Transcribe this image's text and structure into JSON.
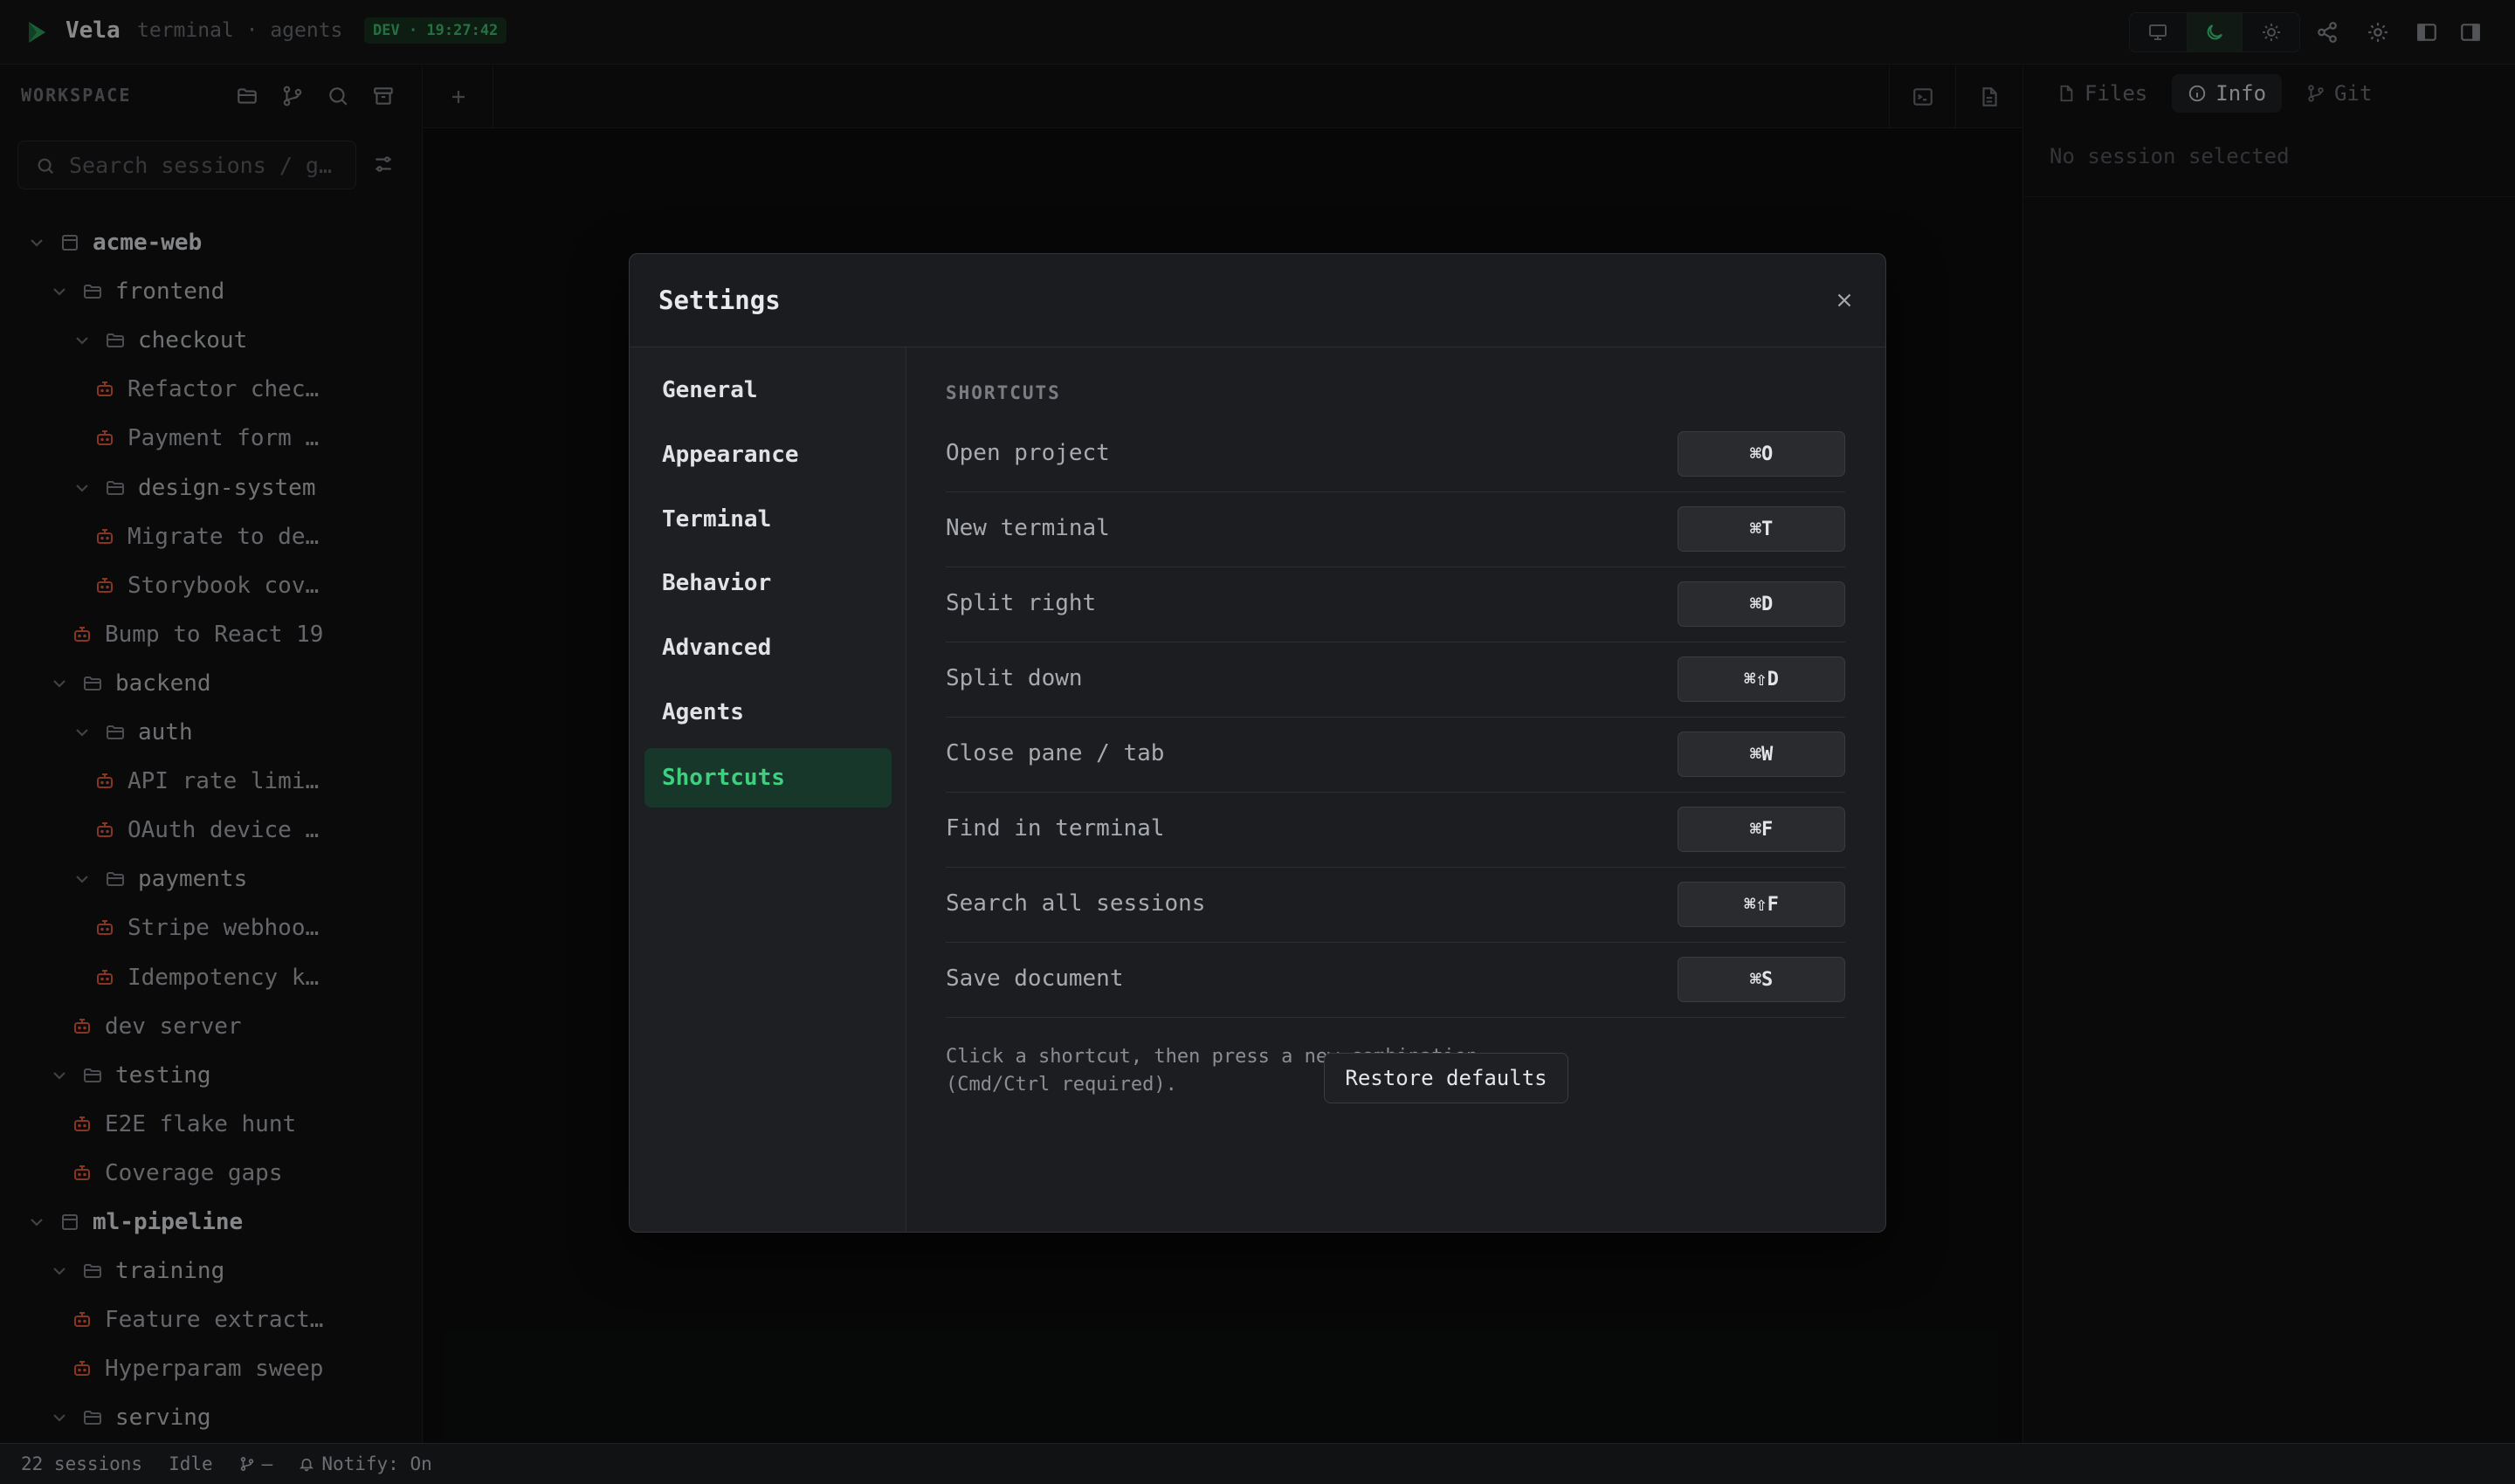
{
  "app": {
    "name": "Vela",
    "subtitle": "terminal · agents",
    "env_badge": "DEV · 19:27:42"
  },
  "topbar": {
    "theme_buttons": [
      "monitor-icon",
      "moon-icon",
      "sun-icon"
    ],
    "active_theme": "moon-icon",
    "actions": [
      "share-icon",
      "settings-icon",
      "sidebar-left-icon",
      "sidebar-right-icon"
    ]
  },
  "sidebar": {
    "header": "WORKSPACE",
    "header_actions": [
      "folder-open-icon",
      "branch-icon",
      "search-icon",
      "archive-icon"
    ],
    "search_placeholder": "Search sessions / g…",
    "tree": [
      {
        "type": "project",
        "label": "acme-web",
        "level": 0
      },
      {
        "type": "folder",
        "label": "frontend",
        "level": 1
      },
      {
        "type": "folder",
        "label": "checkout",
        "level": 2
      },
      {
        "type": "session",
        "label": "Refactor chec…",
        "level": 3
      },
      {
        "type": "session",
        "label": "Payment form …",
        "level": 3
      },
      {
        "type": "folder",
        "label": "design-system",
        "level": 2
      },
      {
        "type": "session",
        "label": "Migrate to de…",
        "level": 3
      },
      {
        "type": "session",
        "label": "Storybook cov…",
        "level": 3
      },
      {
        "type": "session",
        "label": "Bump to React 19",
        "level": 2
      },
      {
        "type": "folder",
        "label": "backend",
        "level": 1
      },
      {
        "type": "folder",
        "label": "auth",
        "level": 2
      },
      {
        "type": "session",
        "label": "API rate limi…",
        "level": 3
      },
      {
        "type": "session",
        "label": "OAuth device …",
        "level": 3
      },
      {
        "type": "folder",
        "label": "payments",
        "level": 2
      },
      {
        "type": "session",
        "label": "Stripe webhoo…",
        "level": 3
      },
      {
        "type": "session",
        "label": "Idempotency k…",
        "level": 3
      },
      {
        "type": "session",
        "label": "dev server",
        "level": 2
      },
      {
        "type": "folder",
        "label": "testing",
        "level": 1
      },
      {
        "type": "session",
        "label": "E2E flake hunt",
        "level": 2
      },
      {
        "type": "session",
        "label": "Coverage gaps",
        "level": 2
      },
      {
        "type": "project",
        "label": "ml-pipeline",
        "level": 0
      },
      {
        "type": "folder",
        "label": "training",
        "level": 1
      },
      {
        "type": "session",
        "label": "Feature extract…",
        "level": 2
      },
      {
        "type": "session",
        "label": "Hyperparam sweep",
        "level": 2
      },
      {
        "type": "folder",
        "label": "serving",
        "level": 1
      }
    ]
  },
  "right_panel": {
    "tabs": [
      {
        "label": "Files",
        "icon": "file-icon"
      },
      {
        "label": "Info",
        "icon": "info-icon"
      },
      {
        "label": "Git",
        "icon": "branch-icon"
      }
    ],
    "active_tab": "Info",
    "empty_text": "No session selected"
  },
  "statusbar": {
    "sessions": "22 sessions",
    "state": "Idle",
    "branch": "—",
    "notify": "Notify: On"
  },
  "settings": {
    "title": "Settings",
    "nav": [
      "General",
      "Appearance",
      "Terminal",
      "Behavior",
      "Advanced",
      "Agents",
      "Shortcuts"
    ],
    "active_nav": "Shortcuts",
    "section_label": "SHORTCUTS",
    "shortcuts": [
      {
        "label": "Open project",
        "keys": "⌘O"
      },
      {
        "label": "New terminal",
        "keys": "⌘T"
      },
      {
        "label": "Split right",
        "keys": "⌘D"
      },
      {
        "label": "Split down",
        "keys": "⌘⇧D"
      },
      {
        "label": "Close pane / tab",
        "keys": "⌘W"
      },
      {
        "label": "Find in terminal",
        "keys": "⌘F"
      },
      {
        "label": "Search all sessions",
        "keys": "⌘⇧F"
      },
      {
        "label": "Save document",
        "keys": "⌘S"
      }
    ],
    "hint": "Click a shortcut, then press a new combination (Cmd/Ctrl required).",
    "restore_label": "Restore defaults"
  },
  "colors": {
    "accent_green": "#3ed07f",
    "session_icon": "#e05a3a",
    "background": "#0e0f10"
  }
}
